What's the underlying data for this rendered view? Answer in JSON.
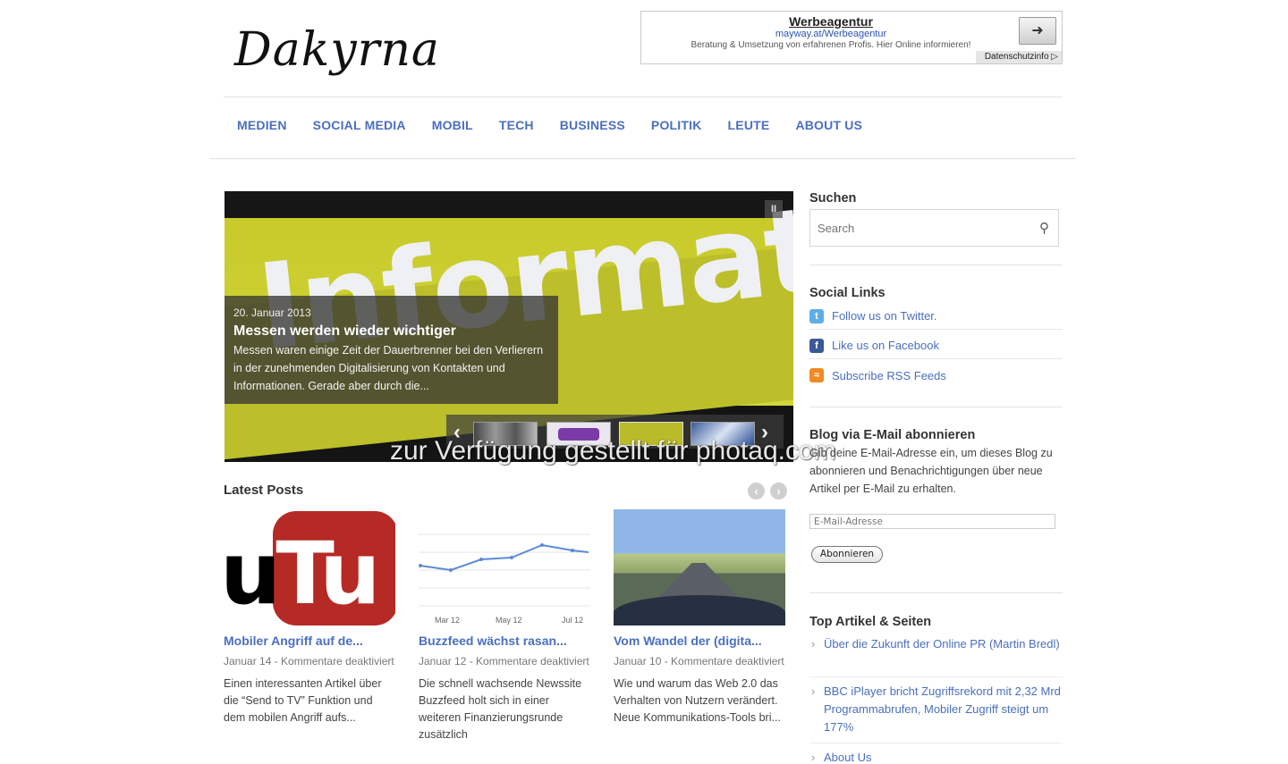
{
  "logo": {
    "text": "Dakyrna"
  },
  "ad": {
    "title": "Werbeagentur",
    "url": "mayway.at/Werbeagentur",
    "description": "Beratung & Umsetzung von erfahrenen Profis. Hier Online informieren!",
    "privacy": "Datenschutzinfo ▷"
  },
  "nav": [
    "MEDIEN",
    "SOCIAL MEDIA",
    "MOBIL",
    "TECH",
    "BUSINESS",
    "POLITIK",
    "LEUTE",
    "ABOUT US"
  ],
  "slider": {
    "image_word": "Information",
    "date": "20. Januar 2013",
    "title": "Messen werden wieder wichtiger",
    "text": "Messen waren einige Zeit der Dauerbrenner bei den Verlierern in der zunehmenden Digitalisierung von Kontakten und Informationen. Gerade aber durch die..."
  },
  "watermark": "zur Verfügung gestellt für photaq.com",
  "latest": {
    "title": "Latest Posts",
    "posts": [
      {
        "title": "Mobiler Angriff auf de...",
        "meta": "Januar 14  -  Kommentare deaktiviert",
        "excerpt": "Einen interessanten Artikel über die “Send to TV” Funktion und dem mobilen Angriff aufs..."
      },
      {
        "title": "Buzzfeed wächst rasan...",
        "meta": "Januar 12  -  Kommentare deaktiviert",
        "excerpt": "Die schnell wachsende Newssite Buzzfeed holt sich in einer weiteren Finanzierungsrunde zusätzlich"
      },
      {
        "title": "Vom Wandel der (digita...",
        "meta": "Januar 10  -  Kommentare deaktiviert",
        "excerpt": "Wie und warum das Web 2.0 das Verhalten von Nutzern verändert.  Neue Kommunikations-Tools bri..."
      }
    ],
    "chart_labels": [
      "Mar 12",
      "May 12",
      "Jul 12"
    ]
  },
  "sidebar": {
    "search_title": "Suchen",
    "search_placeholder": "Search",
    "social_title": "Social Links",
    "social": [
      "Follow us on Twitter.",
      "Like us on Facebook",
      "Subscribe RSS Feeds"
    ],
    "blog_title": "Blog via E-Mail abonnieren",
    "blog_text": "Gib deine E-Mail-Adresse ein, um dieses Blog zu abonnieren und Benachrichtigungen über neue Artikel per E-Mail zu erhalten.",
    "email_placeholder": "E-Mail-Adresse",
    "subscribe": "Abonnieren",
    "top_title": "Top Artikel & Seiten",
    "top": [
      "Über die Zukunft der Online PR (Martin Bredl)",
      "BBC iPlayer bricht Zugriffsrekord mit 2,32 Mrd Programmabrufen, Mobiler Zugriff steigt um 177%",
      "About Us"
    ]
  }
}
